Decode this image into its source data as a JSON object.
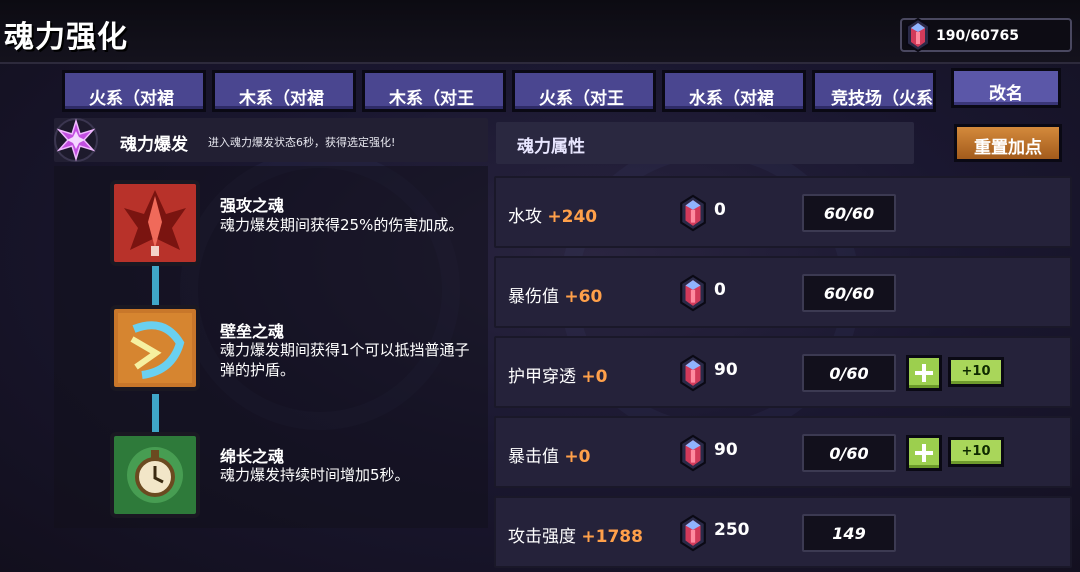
{
  "header": {
    "title": "魂力强化",
    "currency": {
      "value": "190/60765",
      "icon": "soul-crystal-icon"
    }
  },
  "tabs": [
    {
      "label": "火系（对裙"
    },
    {
      "label": "木系（对裙"
    },
    {
      "label": "木系（对王"
    },
    {
      "label": "火系（对王"
    },
    {
      "label": "水系（对裙"
    },
    {
      "label": "竞技场（火系"
    }
  ],
  "rename_label": "改名",
  "burst": {
    "name": "魂力爆发",
    "desc": "进入魂力爆发状态6秒，获得选定强化!",
    "icon": "soul-burst-star-icon"
  },
  "attributes_title": "魂力属性",
  "reset_label": "重置加点",
  "skills": [
    {
      "name": "强攻之魂",
      "desc": "魂力爆发期间获得25%的伤害加成。",
      "icon": "strike-soul-icon"
    },
    {
      "name": "壁垒之魂",
      "desc": "魂力爆发期间获得1个可以抵挡普通子弹的护盾。",
      "icon": "barrier-soul-icon"
    },
    {
      "name": "绵长之魂",
      "desc": "魂力爆发持续时间增加5秒。",
      "icon": "endurance-soul-icon"
    }
  ],
  "attributes": [
    {
      "name": "水攻",
      "bonus": "+240",
      "cost": "0",
      "progress": "60/60"
    },
    {
      "name": "暴伤值",
      "bonus": "+60",
      "cost": "0",
      "progress": "60/60"
    },
    {
      "name": "护甲穿透",
      "bonus": "+0",
      "cost": "90",
      "progress": "0/60",
      "add_ten_label": "+10"
    },
    {
      "name": "暴击值",
      "bonus": "+0",
      "cost": "90",
      "progress": "0/60",
      "add_ten_label": "+10"
    },
    {
      "name": "攻击强度",
      "bonus": "+1788",
      "cost": "250",
      "progress": "149"
    }
  ],
  "colors": {
    "tab": "#4a4690",
    "accent_orange": "#ffa04a",
    "plus_green": "#9ccf4e",
    "reset_orange": "#c0742c"
  }
}
